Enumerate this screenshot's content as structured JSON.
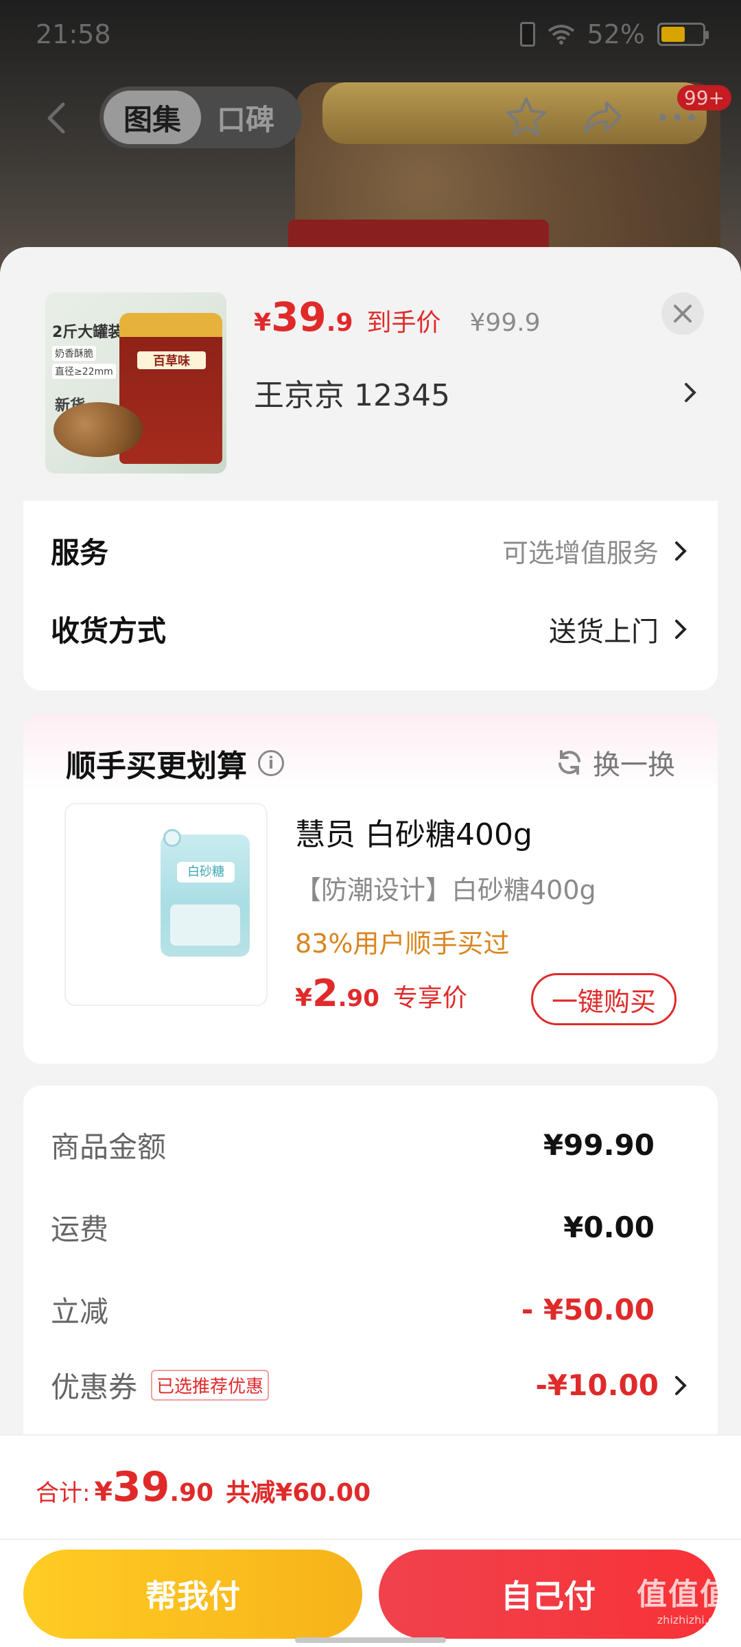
{
  "status_bar": {
    "time": "21:58",
    "battery": "52%"
  },
  "top_nav": {
    "tabs": [
      {
        "label": "图集"
      },
      {
        "label": "口碑"
      }
    ],
    "badge": "99+"
  },
  "product": {
    "thumb_title": "2斤大罐装",
    "thumb_tags": [
      "奶香酥脆",
      "直径≥22mm",
      "新货"
    ],
    "thumb_brand": "百草味",
    "price_yen": "¥",
    "price_int": "39",
    "price_dec": ".9",
    "price_label": "到手价",
    "original_price": "¥99.9",
    "store_name": "王京京  12345"
  },
  "service_card": {
    "rows": [
      {
        "label": "服务",
        "value": "可选增值服务"
      },
      {
        "label": "收货方式",
        "value": "送货上门"
      }
    ]
  },
  "upsell": {
    "title": "顺手买更划算",
    "info_glyph": "i",
    "swap_label": "换一换",
    "bag_label": "白砂糖",
    "item_name": "慧员 白砂糖400g",
    "item_desc": "【防潮设计】白砂糖400g",
    "social_proof": "83%用户顺手买过",
    "price_yen": "¥",
    "price_int": "2",
    "price_dec": ".90",
    "price_label": "专享价",
    "buy_label": "一键购买"
  },
  "summary": {
    "rows": [
      {
        "label": "商品金额",
        "value": "¥99.90"
      },
      {
        "label": "运费",
        "value": "¥0.00"
      },
      {
        "label": "立减",
        "value": "- ¥50.00"
      },
      {
        "label": "优惠券",
        "tag": "已选推荐优惠",
        "value": "-¥10.00"
      }
    ]
  },
  "footer": {
    "total_label": "合计:",
    "total_yen": "¥",
    "total_int": "39",
    "total_dec": ".90",
    "total_saved": "共减¥60.00",
    "help_pay_label": "帮我付",
    "self_pay_label": "自己付"
  },
  "watermark": {
    "big": "值值值",
    "small": "zhizhizhi.com"
  },
  "colors": {
    "accent_red": "#e02a2a",
    "accent_yellow": "#f7b31a",
    "social_orange": "#d9851f"
  }
}
